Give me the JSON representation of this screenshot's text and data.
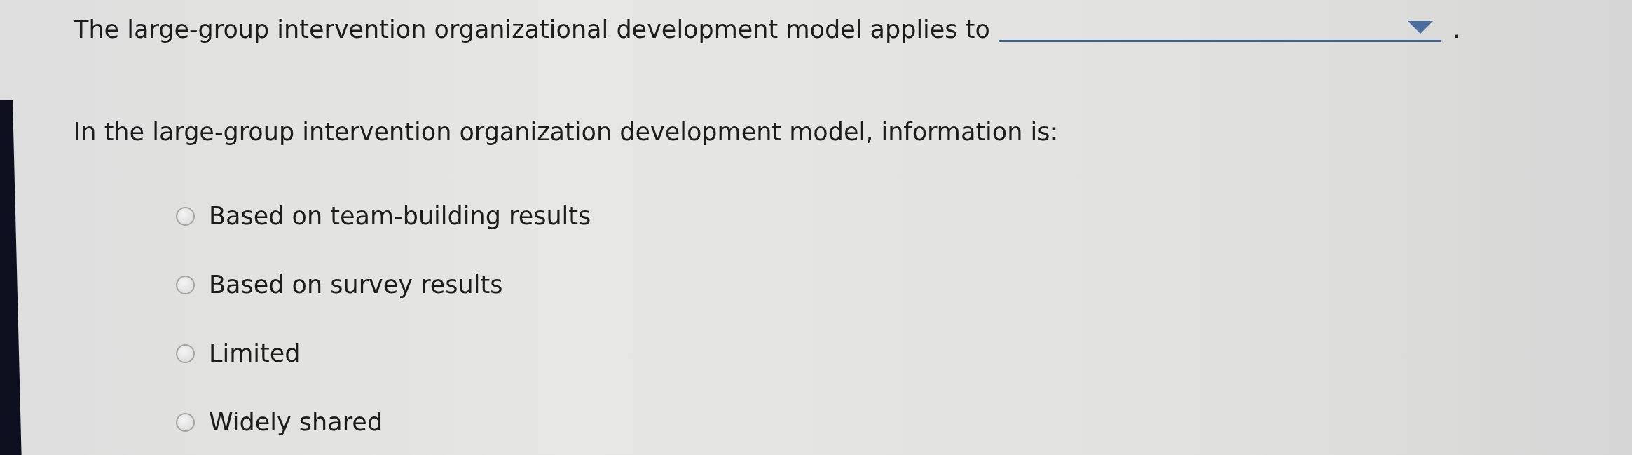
{
  "questions": [
    {
      "kind": "dropdown_blank",
      "prompt": "The large-group intervention organizational development model applies to",
      "after": "."
    },
    {
      "kind": "multiple_choice",
      "prompt": "In the large-group intervention organization development model, information is:",
      "options": [
        {
          "label": "Based on team-building results",
          "selected": false
        },
        {
          "label": "Based on survey results",
          "selected": false
        },
        {
          "label": "Limited",
          "selected": false
        },
        {
          "label": "Widely shared",
          "selected": false
        }
      ]
    }
  ]
}
